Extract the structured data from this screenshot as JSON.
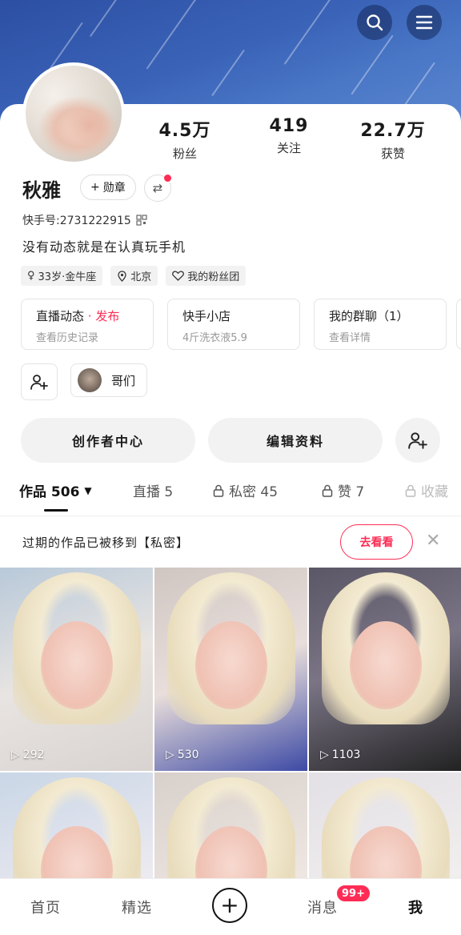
{
  "header": {
    "search_icon": "search-icon",
    "menu_icon": "menu-icon"
  },
  "profile": {
    "nickname": "秋雅",
    "medal_label": "勋章",
    "kuaishou_id": "快手号:2731222915",
    "bio": "没有动态就是在认真玩手机"
  },
  "stats": [
    {
      "value": "4.5万",
      "label": "粉丝"
    },
    {
      "value": "419",
      "label": "关注"
    },
    {
      "value": "22.7万",
      "label": "获赞"
    }
  ],
  "tags": [
    {
      "icon": "female-icon",
      "label": "33岁·金牛座"
    },
    {
      "icon": "location-icon",
      "label": "北京"
    },
    {
      "icon": "heart-icon",
      "label": "我的粉丝团"
    }
  ],
  "cards": [
    {
      "title": "直播动态",
      "title_accent": "发布",
      "subtitle": "查看历史记录"
    },
    {
      "title": "快手小店",
      "title_accent": "",
      "subtitle": "4斤洗衣液5.9"
    },
    {
      "title": "我的群聊（1）",
      "title_accent": "",
      "subtitle": "查看详情"
    }
  ],
  "friends": {
    "chip_label": "哥们"
  },
  "actions": {
    "creator_center": "创作者中心",
    "edit_profile": "编辑资料"
  },
  "tabs": [
    {
      "label": "作品 506"
    },
    {
      "label": "直播 5"
    },
    {
      "label": "私密 45"
    },
    {
      "label": "赞 7"
    },
    {
      "label": "收藏"
    }
  ],
  "notice": {
    "text": "过期的作品已被移到【私密】",
    "button": "去看看"
  },
  "videos": [
    {
      "plays": "292"
    },
    {
      "plays": "530"
    },
    {
      "plays": "1103"
    },
    {
      "plays": ""
    },
    {
      "plays": ""
    },
    {
      "plays": ""
    }
  ],
  "bottom_nav": {
    "home": "首页",
    "featured": "精选",
    "messages": "消息",
    "messages_badge": "99+",
    "me": "我"
  },
  "colors": {
    "accent": "#fe2c55",
    "banner": "#3a63b8"
  }
}
